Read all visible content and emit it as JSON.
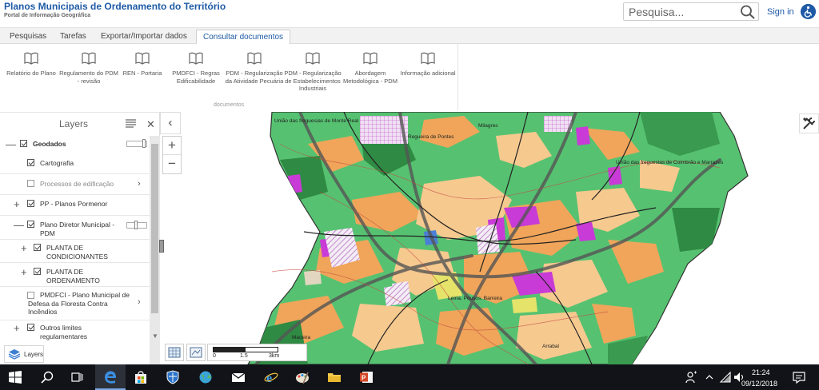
{
  "header": {
    "title": "Planos Municipais de Ordenamento do Território",
    "subtitle": "Portal de Informação Geográfica",
    "search_placeholder": "Pesquisa...",
    "sign_in": "Sign in"
  },
  "tabs": [
    {
      "label": "Pesquisas",
      "active": false
    },
    {
      "label": "Tarefas",
      "active": false
    },
    {
      "label": "Exportar/Importar dados",
      "active": false
    },
    {
      "label": "Consultar documentos",
      "active": true
    }
  ],
  "ribbon": {
    "group_label": "documentos",
    "buttons": [
      {
        "icon": "book-icon",
        "label": "Relatório do Plano"
      },
      {
        "icon": "book-icon",
        "label": "Regulamento do PDM - revisão"
      },
      {
        "icon": "book-icon",
        "label": "REN - Portaria"
      },
      {
        "icon": "book-icon",
        "label": "PMDFCI - Regras Edificabilidade"
      },
      {
        "icon": "book-icon",
        "label": "PDM - Regularização da Atividade Pecuária"
      },
      {
        "icon": "book-icon",
        "label": "PDM - Regularização de Estabelecimentos Industriais"
      },
      {
        "icon": "book-icon",
        "label": "Abordagem Metodológica - PDM"
      },
      {
        "icon": "book-icon",
        "label": "Informação adicional"
      }
    ]
  },
  "layers_panel": {
    "title": "Layers",
    "tab_label": "Layers",
    "rows": [
      {
        "label": "Geodados",
        "checked": true,
        "expander": "—",
        "bold": true
      },
      {
        "label": "Cartografia",
        "checked": true
      },
      {
        "label": "Processos de edificação",
        "checked": false,
        "dim": true
      },
      {
        "label": "PP - Planos Pormenor",
        "checked": true,
        "expander": "+"
      },
      {
        "label": "Plano Diretor Municipal - PDM",
        "checked": true,
        "expander": "—"
      },
      {
        "label": "PLANTA DE CONDICIONANTES",
        "checked": true,
        "expander": "+"
      },
      {
        "label": "PLANTA DE ORDENAMENTO",
        "checked": true,
        "expander": "+"
      },
      {
        "label": "PMDFCI - Plano Municipal de Defesa da Floresta Contra Incêndios",
        "checked": false
      },
      {
        "label": "Outros limites regulamentares",
        "checked": true,
        "expander": "+"
      }
    ]
  },
  "map": {
    "scale_labels": [
      "0",
      "1.5",
      "3km"
    ],
    "place_names": [
      "União das freguesias de Monte Real",
      "União das freguesias de Coimbrão e Marrazes",
      "Regueira de Pontes",
      "Leiria, Pousos, Barreira",
      "Arrabal",
      "Milagres",
      "Maceira"
    ],
    "colors": {
      "green": "#56c271",
      "orange": "#f0a55a",
      "dark_green": "#2f8a43",
      "magenta": "#c83bd6",
      "light_orange": "#f6c98f",
      "yellow": "#e6e36a"
    }
  },
  "taskbar": {
    "time": "21:24",
    "date": "09/12/2018"
  }
}
